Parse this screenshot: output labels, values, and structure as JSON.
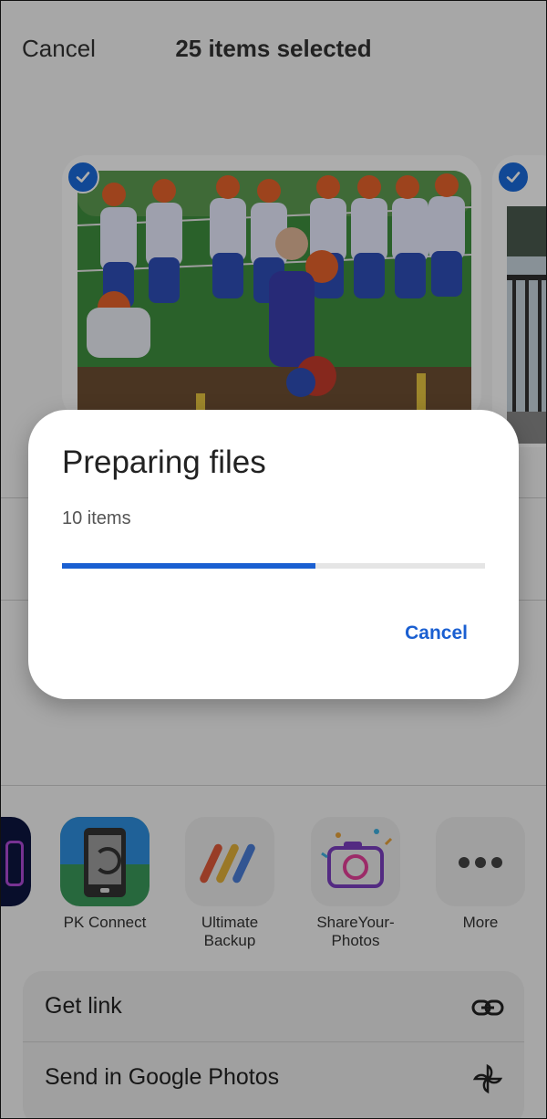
{
  "header": {
    "cancel_label": "Cancel",
    "title": "25 items selected"
  },
  "photos": [
    {
      "name": "football-photo",
      "selected": true
    },
    {
      "name": "deck-photo",
      "selected": true
    }
  ],
  "share_apps": [
    {
      "label": "PK Connect",
      "icon": "pk-connect-icon"
    },
    {
      "label": "Ultimate\nBackup",
      "icon": "ultimate-backup-icon"
    },
    {
      "label": "ShareYour-\nPhotos",
      "icon": "shareyourphotos-icon"
    },
    {
      "label": "More",
      "icon": "more-icon"
    }
  ],
  "actions": [
    {
      "label": "Get link",
      "icon": "link-icon"
    },
    {
      "label": "Send in Google Photos",
      "icon": "pinwheel-icon"
    }
  ],
  "dialog": {
    "title": "Preparing files",
    "subtitle": "10 items",
    "progress": 0.6,
    "cancel_label": "Cancel"
  },
  "colors": {
    "accent": "#1a5fd1",
    "check": "#1a6bdc"
  }
}
